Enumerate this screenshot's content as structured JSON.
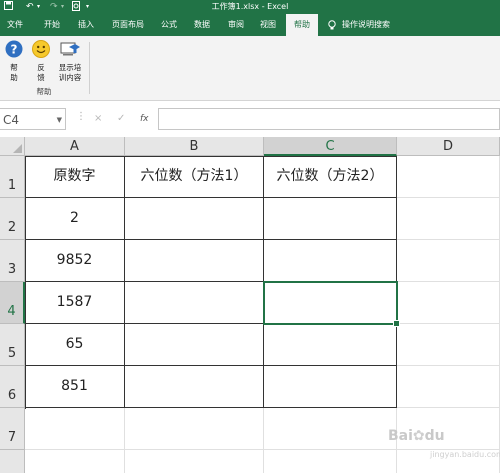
{
  "window": {
    "title": "工作簿1.xlsx - Excel",
    "quick_access": [
      "save-icon",
      "undo-icon",
      "redo-icon",
      "print-preview-icon",
      "dropdown-icon"
    ]
  },
  "ribbon_tabs": [
    {
      "label": "文件",
      "active": false
    },
    {
      "label": "开始",
      "active": false
    },
    {
      "label": "插入",
      "active": false
    },
    {
      "label": "页面布局",
      "active": false
    },
    {
      "label": "公式",
      "active": false
    },
    {
      "label": "数据",
      "active": false
    },
    {
      "label": "审阅",
      "active": false
    },
    {
      "label": "视图",
      "active": false
    },
    {
      "label": "帮助",
      "active": true
    }
  ],
  "tell_me": "操作说明搜索",
  "ribbon": {
    "buttons": [
      {
        "label_line1": "帮",
        "label_line2": "助",
        "icon": "help-icon"
      },
      {
        "label_line1": "反",
        "label_line2": "馈",
        "icon": "smiley-icon"
      },
      {
        "label_line1": "显示培",
        "label_line2": "训内容",
        "icon": "training-icon"
      }
    ],
    "group_label": "帮助"
  },
  "formula_bar": {
    "name_box": "C4",
    "cancel_symbol": "×",
    "enter_symbol": "✓",
    "fx_symbol": "fx",
    "formula": ""
  },
  "sheet": {
    "columns": [
      "A",
      "B",
      "C",
      "D"
    ],
    "selected_column": "C",
    "rows": [
      "1",
      "2",
      "3",
      "4",
      "5",
      "6",
      "7"
    ],
    "selected_row": "4",
    "active_cell": "C4",
    "cells": [
      [
        "原数字",
        "六位数（方法1）",
        "六位数（方法2）",
        ""
      ],
      [
        "2",
        "",
        "",
        ""
      ],
      [
        "9852",
        "",
        "",
        ""
      ],
      [
        "1587",
        "",
        "",
        ""
      ],
      [
        "65",
        "",
        "",
        ""
      ],
      [
        "851",
        "",
        "",
        ""
      ],
      [
        "",
        "",
        "",
        ""
      ]
    ]
  },
  "watermark": {
    "text": "Bai",
    "text2": "du",
    "sub": "jingyan.baidu.com"
  },
  "colors": {
    "excel_green": "#217346",
    "ribbon_bg": "#f3f3f3",
    "header_bg": "#e6e6e6"
  }
}
